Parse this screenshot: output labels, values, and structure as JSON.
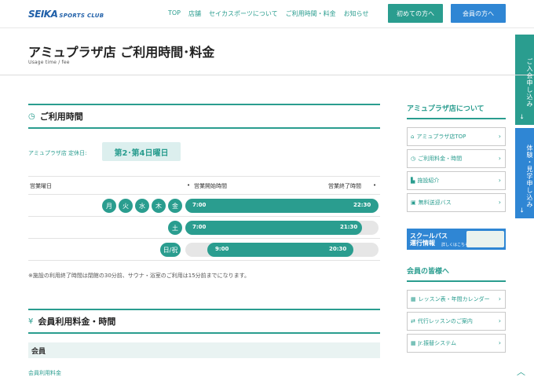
{
  "header": {
    "logo_main": "SEIKA",
    "logo_sub": "SPORTS CLUB",
    "nav": [
      "TOP",
      "店舗",
      "セイカスポーツについて",
      "ご利用時間・料金",
      "お知らせ"
    ],
    "btn_first": "初めての方へ",
    "btn_member": "会員の方へ"
  },
  "side_tabs": {
    "join": "ご入会申し込み",
    "trial": "体験・見学申し込み",
    "arrow": "→"
  },
  "page": {
    "title": "アミュプラザ店 ご利用時間･料金",
    "subtitle": "Usage time / fee"
  },
  "hours": {
    "heading_icon": "clock-icon",
    "heading": "ご利用時間",
    "closed_label": "アミュプラザ店 定休日:",
    "closed_value": "第2･第4日曜日",
    "col_day": "営業曜日",
    "col_open": "営業開始時間",
    "col_close": "営業終了時間",
    "rows": [
      {
        "days": [
          "月",
          "火",
          "水",
          "木",
          "金"
        ],
        "open": "7:00",
        "close": "22:30"
      },
      {
        "days": [
          "土"
        ],
        "open": "7:00",
        "close": "21:30"
      },
      {
        "days": [
          "日/祝"
        ],
        "open": "9:00",
        "close": "20:30"
      }
    ],
    "note": "※施設の利用終了時間は閉館の30分前、サウナ・浴室のご利用は15分前までになります。"
  },
  "fees": {
    "heading_icon": "yen-icon",
    "heading": "会員利用料金・時間",
    "sub_heading": "会員",
    "sub_text": "会員利用料金"
  },
  "sidebar": {
    "about_title": "アミュプラザ店について",
    "about_items": [
      {
        "label": "アミュプラザ店TOP",
        "icon": "home-icon",
        "glyph": "⌂"
      },
      {
        "label": "ご利用料金・時間",
        "icon": "clock-icon",
        "glyph": "◷"
      },
      {
        "label": "施設紹介",
        "icon": "building-icon",
        "glyph": "▙"
      },
      {
        "label": "無料送迎バス",
        "icon": "bus-icon",
        "glyph": "▣"
      }
    ],
    "banner_text_1": "スクールバス",
    "banner_text_2": "運行情報",
    "banner_small": "詳しくはこちら",
    "member_title": "会員の皆様へ",
    "member_items": [
      {
        "label": "レッスン表・年間カレンダー",
        "icon": "calendar-icon",
        "glyph": "▦"
      },
      {
        "label": "代行レッスンのご案内",
        "icon": "swap-icon",
        "glyph": "⇄"
      },
      {
        "label": "Jr.振替システム",
        "icon": "calendar-icon",
        "glyph": "▦"
      }
    ],
    "chevron": "›"
  },
  "colors": {
    "teal": "#2a9d8f",
    "blue": "#2f86d4",
    "light_teal": "#dcefee"
  }
}
